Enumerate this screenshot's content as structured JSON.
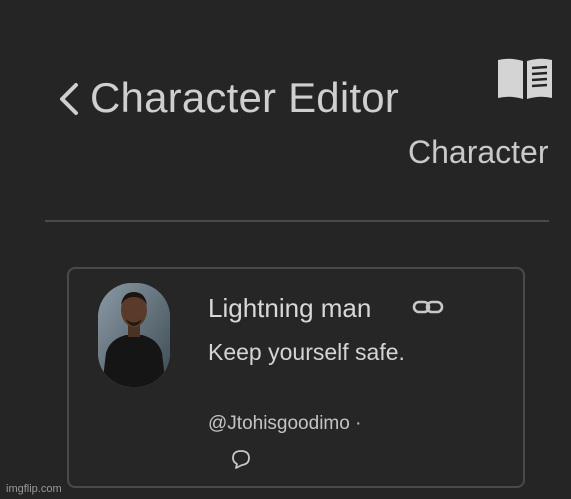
{
  "header": {
    "back_icon": "chevron-left-icon",
    "title": "Character Editor",
    "book_icon": "book-open-icon",
    "subtitle": "Character"
  },
  "card": {
    "name": "Lightning man",
    "link_icon": "link-icon",
    "greeting": "Keep yourself safe.",
    "handle": "@Jtohisgoodimo ·",
    "chat_icon": "chat-bubble-icon"
  },
  "watermark": "imgflip.com",
  "colors": {
    "background": "#252525",
    "text": "#d6d6d6",
    "divider": "#4a4a4a"
  }
}
